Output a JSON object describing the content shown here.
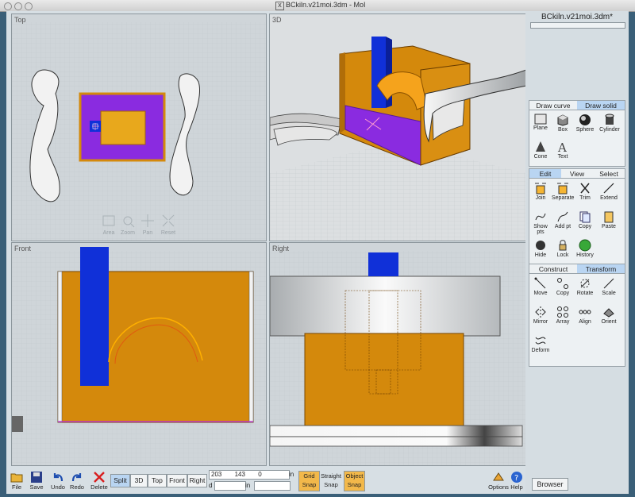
{
  "window": {
    "title": "BCkiln.v21moi.3dm - MoI"
  },
  "viewports": {
    "top": {
      "label": "Top"
    },
    "threed": {
      "label": "3D"
    },
    "front": {
      "label": "Front"
    },
    "right": {
      "label": "Right"
    },
    "nav": {
      "area": "Area",
      "zoom": "Zoom",
      "pan": "Pan",
      "reset": "Reset"
    }
  },
  "panel": {
    "doc_title": "BCkiln.v21moi.3dm*",
    "draw_tabs": [
      "Draw curve",
      "Draw solid"
    ],
    "draw_tools": [
      "Plane",
      "Box",
      "Sphere",
      "Cylinder",
      "Cone",
      "Text"
    ],
    "edit_tabs": [
      "Edit",
      "View",
      "Select"
    ],
    "edit_tools": [
      "Join",
      "Separate",
      "Trim",
      "Extend",
      "Show pts",
      "Add pt",
      "Copy",
      "Paste",
      "Hide",
      "Lock",
      "History"
    ],
    "transform_tabs": [
      "Construct",
      "Transform"
    ],
    "transform_tools": [
      "Move",
      "Copy",
      "Rotate",
      "Scale",
      "Mirror",
      "Array",
      "Align",
      "Orient",
      "Deform"
    ],
    "browser": "Browser"
  },
  "bottombar": {
    "file": "File",
    "save": "Save",
    "undo": "Undo",
    "redo": "Redo",
    "delete": "Delete",
    "views": [
      "Split",
      "3D",
      "Top",
      "Front",
      "Right"
    ],
    "coord_x": "203",
    "coord_y": "143",
    "coord_z": "0",
    "unit": "in",
    "d_label": "d",
    "unit2": "in",
    "grid_snap": "Grid Snap",
    "straight_snap": "Straight Snap",
    "object_snap": "Object Snap",
    "options": "Options",
    "help": "Help"
  },
  "colors": {
    "orange": "#d4890c",
    "purple": "#8a2be0",
    "blue": "#1030d8",
    "highlight": "#b9d5f2"
  }
}
